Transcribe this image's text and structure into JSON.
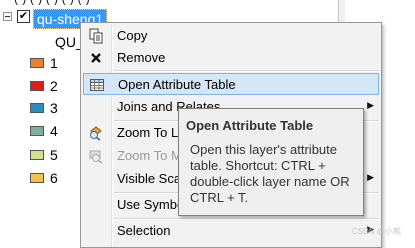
{
  "toc": {
    "layer_name": "qu-sheng1",
    "field_name": "QU_",
    "legend": [
      {
        "label": "1",
        "color": "#f07d33"
      },
      {
        "label": "2",
        "color": "#e31a1c"
      },
      {
        "label": "3",
        "color": "#2b8cbe"
      },
      {
        "label": "4",
        "color": "#7fb09a"
      },
      {
        "label": "5",
        "color": "#cfe38a"
      },
      {
        "label": "6",
        "color": "#f2c14e"
      }
    ]
  },
  "context_menu": {
    "items": [
      {
        "label": "Copy",
        "icon": "copy-icon",
        "enabled": true,
        "submenu": false
      },
      {
        "label": "Remove",
        "icon": "remove-x-icon",
        "enabled": true,
        "submenu": false
      },
      {
        "label": "Open Attribute Table",
        "icon": "table-icon",
        "enabled": true,
        "submenu": false,
        "highlighted": true
      },
      {
        "label": "Joins and Relates",
        "icon": "",
        "enabled": true,
        "submenu": true
      },
      {
        "label": "Zoom To L",
        "icon": "zoom-to-layer-icon",
        "enabled": true,
        "submenu": false
      },
      {
        "label": "Zoom To M",
        "icon": "zoom-to-scale-icon",
        "enabled": false,
        "submenu": false
      },
      {
        "label": "Visible Sca",
        "icon": "",
        "enabled": true,
        "submenu": true
      },
      {
        "label": "Use Symbo",
        "icon": "",
        "enabled": true,
        "submenu": false
      },
      {
        "label": "Selection",
        "icon": "",
        "enabled": true,
        "submenu": true
      }
    ]
  },
  "tooltip": {
    "title": "Open Attribute Table",
    "body": "Open this layer's attribute table. Shortcut: CTRL + double-click layer name OR CTRL + T."
  },
  "watermark": "CSDN @小熊"
}
